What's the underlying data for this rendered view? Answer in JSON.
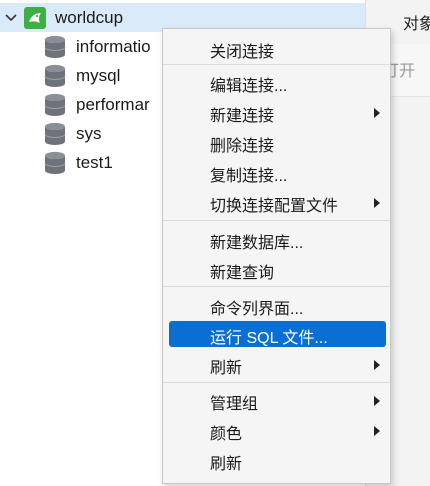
{
  "tree": {
    "connection": {
      "label": "worldcup"
    },
    "databases": [
      {
        "label": "informatio"
      },
      {
        "label": "mysql"
      },
      {
        "label": "performar"
      },
      {
        "label": "sys"
      },
      {
        "label": "test1"
      }
    ]
  },
  "right_panel": {
    "title": "对象",
    "toolbar_text": "打开"
  },
  "context_menu": {
    "items": [
      {
        "label": "关闭连接",
        "submenu": false
      },
      {
        "label": "编辑连接...",
        "submenu": false
      },
      {
        "label": "新建连接",
        "submenu": true
      },
      {
        "label": "删除连接",
        "submenu": false
      },
      {
        "label": "复制连接...",
        "submenu": false
      },
      {
        "label": "切换连接配置文件",
        "submenu": true
      },
      {
        "label": "新建数据库...",
        "submenu": false
      },
      {
        "label": "新建查询",
        "submenu": false
      },
      {
        "label": "命令列界面...",
        "submenu": false
      },
      {
        "label": "运行 SQL 文件...",
        "submenu": false,
        "highlighted": true
      },
      {
        "label": "刷新",
        "submenu": true
      },
      {
        "label": "管理组",
        "submenu": true
      },
      {
        "label": "颜色",
        "submenu": true
      },
      {
        "label": "刷新",
        "submenu": false
      }
    ]
  },
  "colors": {
    "selection": "#dbeaf9",
    "menu_highlight": "#0a6fd2",
    "connection_icon": "#3cb043"
  }
}
